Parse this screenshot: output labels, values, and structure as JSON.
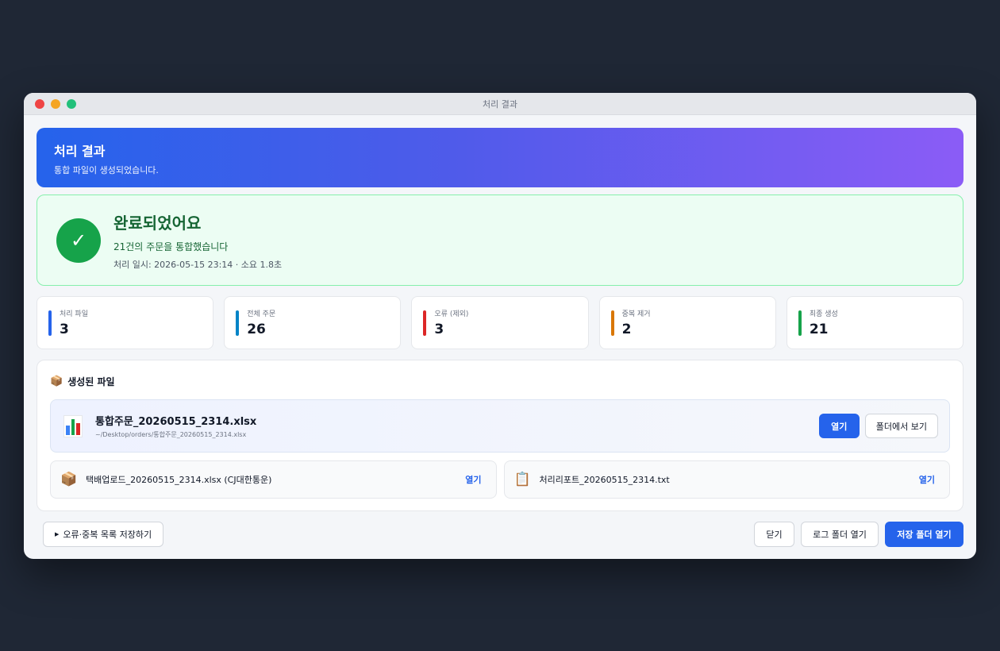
{
  "window": {
    "title": "처리 결과"
  },
  "hero": {
    "title": "처리 결과",
    "subtitle": "통합 파일이 생성되었습니다."
  },
  "success": {
    "icon": "check-icon",
    "title": "완료되었어요",
    "message": "21건의 주문을 통합했습니다",
    "meta": "처리 일시: 2026-05-15 23:14 · 소요 1.8초"
  },
  "stats": [
    {
      "label": "처리 파일",
      "value": "3",
      "color": "#2563eb"
    },
    {
      "label": "전체 주문",
      "value": "26",
      "color": "#0284c7"
    },
    {
      "label": "오류 (제외)",
      "value": "3",
      "color": "#dc2626"
    },
    {
      "label": "중복 제거",
      "value": "2",
      "color": "#d97706"
    },
    {
      "label": "최종 생성",
      "value": "21",
      "color": "#16a34a"
    }
  ],
  "files": {
    "title": "생성된 파일",
    "title_icon": "package-icon",
    "main": {
      "icon": "bar-chart-icon",
      "name": "통합주문_20260515_2314.xlsx",
      "path": "~/Desktop/orders/통합주문_20260515_2314.xlsx",
      "open_label": "열기",
      "reveal_label": "폴더에서 보기"
    },
    "others": [
      {
        "icon": "package-icon",
        "name": "택배업로드_20260515_2314.xlsx (CJ대한통운)",
        "open_label": "열기"
      },
      {
        "icon": "clipboard-icon",
        "name": "처리리포트_20260515_2314.txt",
        "open_label": "열기"
      }
    ]
  },
  "footer": {
    "errors_label": "오류·중복 목록 저장하기",
    "close_label": "닫기",
    "log_folder_label": "로그 폴더 열기",
    "save_folder_label": "저장 폴더 열기"
  }
}
